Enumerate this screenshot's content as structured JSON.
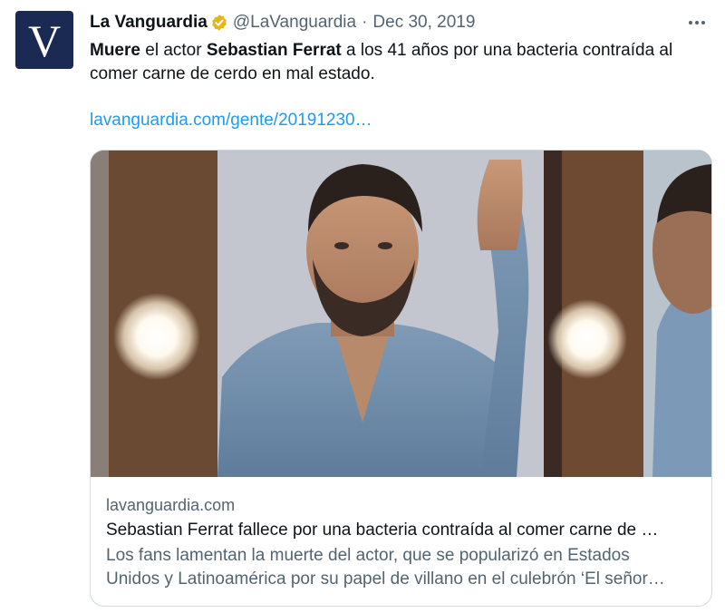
{
  "account": {
    "avatar_letter": "V",
    "name": "La Vanguardia",
    "handle": "@LaVanguardia",
    "separator": "·",
    "date": "Dec 30, 2019",
    "verified_icon": "verified-badge-gold"
  },
  "tweet": {
    "text_bold_1": "Muere",
    "text_1": " el actor ",
    "text_bold_2": "Sebastian Ferrat",
    "text_2": " a los 41 años por una bacteria contraída al comer carne de cerdo en mal estado.",
    "link": "lavanguardia.com/gente/20191230…"
  },
  "card": {
    "domain": "lavanguardia.com",
    "title": "Sebastian Ferrat fallece por una bacteria contraída al comer carne de …",
    "description_line_1": "Los fans lamentan la muerte del actor, que se popularizó en Estados",
    "description_line_2": "Unidos y Latinoamérica por su papel de villano en el culebrón ‘El señor…"
  },
  "colors": {
    "avatar_bg": "#1b2a52",
    "link": "#1d9bf0",
    "secondary_text": "#536471",
    "verified": "#e2b719"
  }
}
